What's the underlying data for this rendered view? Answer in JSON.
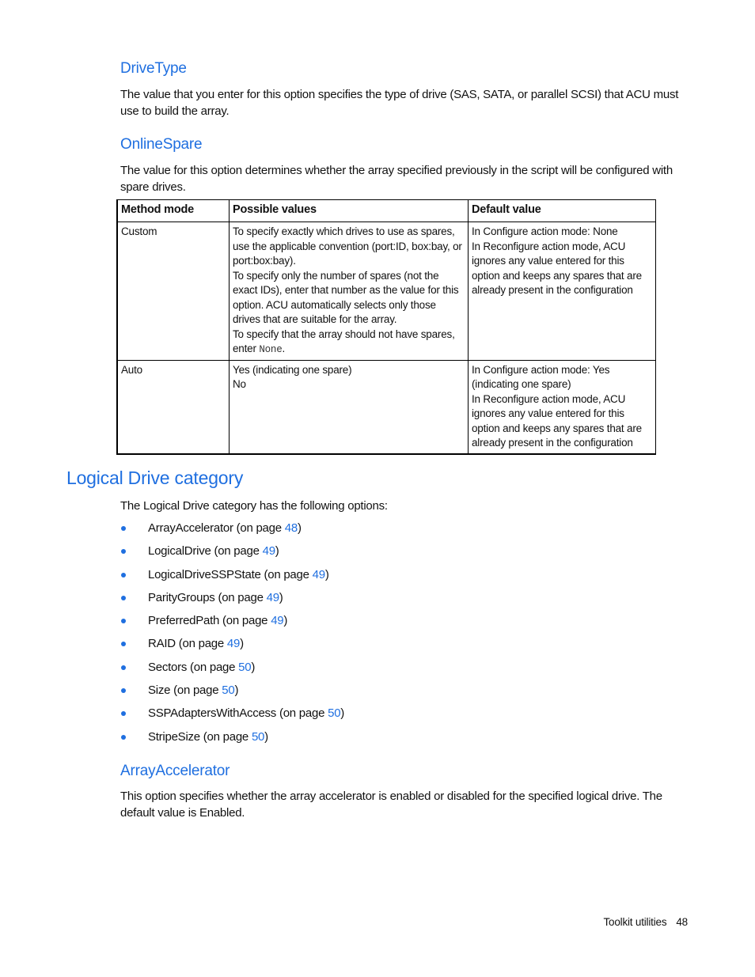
{
  "sections": {
    "drivetype": {
      "heading": "DriveType",
      "body": "The value that you enter for this option specifies the type of drive (SAS, SATA, or parallel SCSI) that ACU must use to build the array."
    },
    "onlinespare": {
      "heading": "OnlineSpare",
      "body": "The value for this option determines whether the array specified previously in the script will be configured with spare drives."
    },
    "logical_drive": {
      "heading": "Logical Drive category",
      "intro": "The Logical Drive category has the following options:"
    },
    "arrayaccelerator": {
      "heading": "ArrayAccelerator",
      "body": "This option specifies whether the array accelerator is enabled or disabled for the specified logical drive. The default value is Enabled."
    }
  },
  "table": {
    "headers": [
      "Method mode",
      "Possible values",
      "Default value"
    ],
    "rows": [
      {
        "method": "Custom",
        "possible": [
          "To specify exactly which drives to use as spares, use the applicable convention (port:ID, box:bay, or port:box:bay).",
          "To specify only the number of spares (not the exact IDs), enter that number as the value for this option. ACU automatically selects only those drives that are suitable for the array.",
          "To specify that the array should not have spares, enter "
        ],
        "possible_code": "None",
        "possible_code_suffix": ".",
        "default": [
          "In Configure action mode: None",
          "In Reconfigure action mode, ACU ignores any value entered for this option and keeps any spares that are already present in the configuration"
        ]
      },
      {
        "method": "Auto",
        "possible": [
          "Yes (indicating one spare)",
          "No"
        ],
        "default": [
          "In Configure action mode: Yes (indicating one spare)",
          "In Reconfigure action mode, ACU ignores any value entered for this option and keeps any spares that are already present in the configuration"
        ]
      }
    ]
  },
  "options_list": [
    {
      "name": "ArrayAccelerator",
      "prefix": " (on page ",
      "page": "48",
      "suffix": ")"
    },
    {
      "name": "LogicalDrive",
      "prefix": " (on page ",
      "page": "49",
      "suffix": ")"
    },
    {
      "name": "LogicalDriveSSPState",
      "prefix": " (on page ",
      "page": "49",
      "suffix": ")"
    },
    {
      "name": "ParityGroups",
      "prefix": " (on page ",
      "page": "49",
      "suffix": ")"
    },
    {
      "name": "PreferredPath",
      "prefix": " (on page ",
      "page": "49",
      "suffix": ")"
    },
    {
      "name": "RAID",
      "prefix": " (on page ",
      "page": "49",
      "suffix": ")"
    },
    {
      "name": "Sectors",
      "prefix": " (on page ",
      "page": "50",
      "suffix": ")"
    },
    {
      "name": "Size",
      "prefix": " (on page ",
      "page": "50",
      "suffix": ")"
    },
    {
      "name": "SSPAdaptersWithAccess",
      "prefix": " (on page ",
      "page": "50",
      "suffix": ")"
    },
    {
      "name": "StripeSize",
      "prefix": " (on page ",
      "page": "50",
      "suffix": ")"
    }
  ],
  "footer": {
    "section": "Toolkit utilities",
    "page_number": "48"
  },
  "colors": {
    "heading": "#1f6fe0",
    "link": "#1f6fe0",
    "text": "#111111"
  }
}
